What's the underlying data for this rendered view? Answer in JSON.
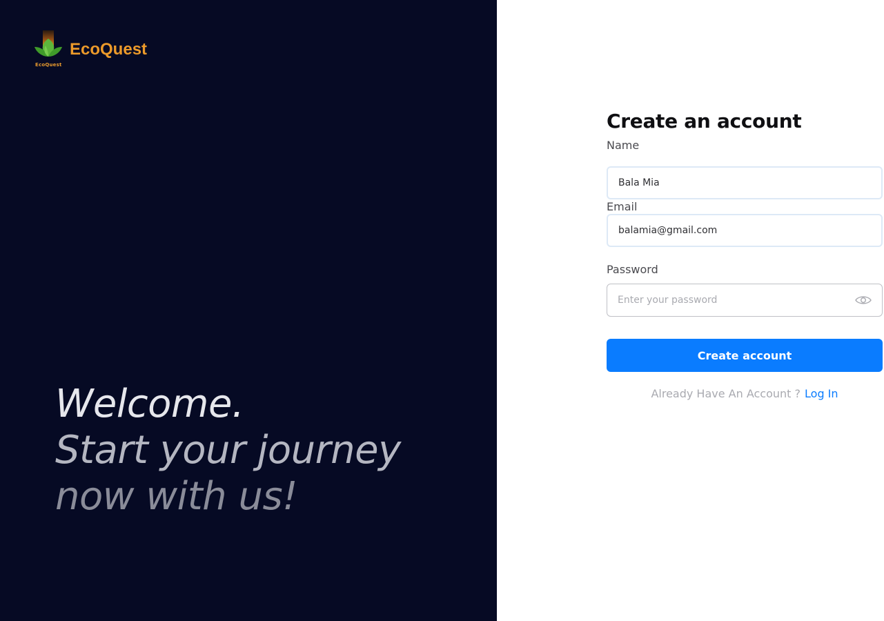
{
  "brand": {
    "name": "EcoQuest",
    "logo_caption": "EcoQuest",
    "logo_icon": "lotus-icon",
    "color": "#ec9a2a"
  },
  "hero": {
    "line1": "Welcome.",
    "line2": "Start your journey",
    "line3": "now with us!"
  },
  "form": {
    "title": "Create an account",
    "name_label": "Name",
    "name_value": "Bala Mia",
    "email_label": "Email",
    "email_value": "balamia@gmail.com",
    "password_label": "Password",
    "password_placeholder": "Enter your password",
    "password_toggle_icon": "eye-icon",
    "submit_label": "Create account",
    "login_prompt": "Already Have An Account ?",
    "login_link": "Log In"
  },
  "colors": {
    "left_background": "#060a24",
    "accent": "#0a7cff"
  }
}
